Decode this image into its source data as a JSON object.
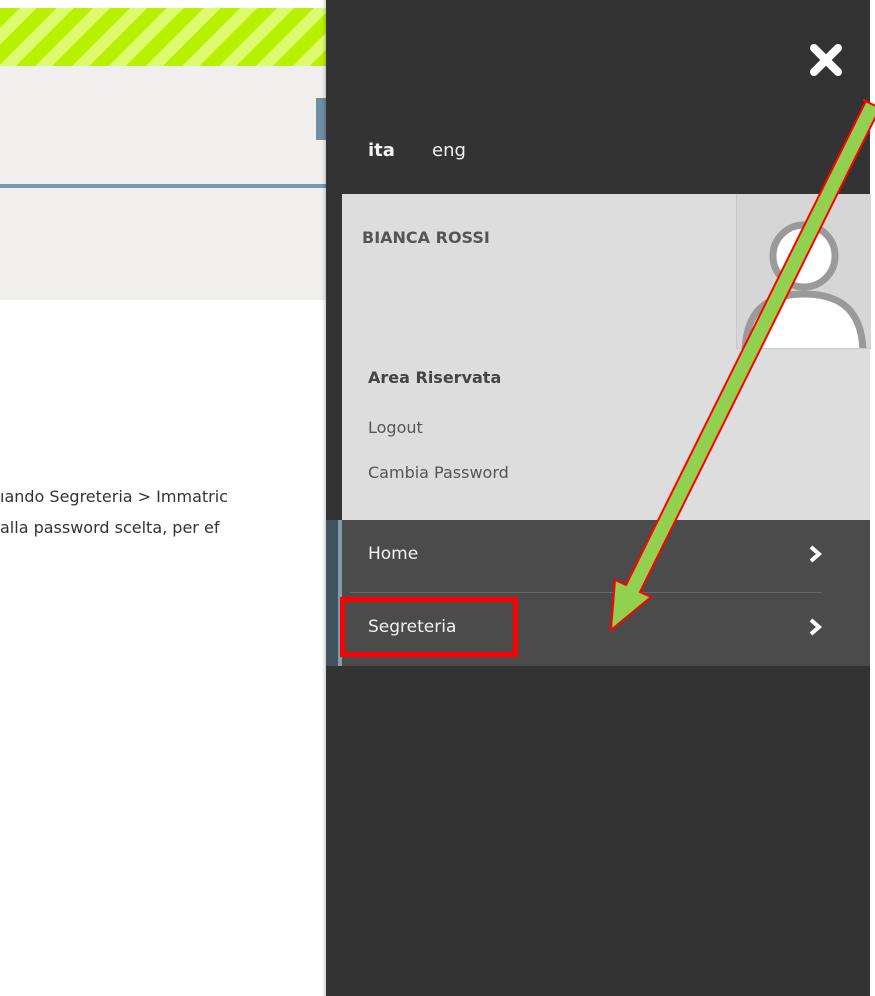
{
  "background": {
    "body_lines": [
      "ıando Segreteria > Immatric",
      " alla password scelta, per ef"
    ]
  },
  "panel": {
    "close_icon": "close-icon",
    "languages": [
      "ita",
      "eng"
    ],
    "active_language": "ita",
    "user": {
      "name": "BIANCA ROSSI",
      "avatar_icon": "user-avatar-icon",
      "area_title": "Area Riservata",
      "links": [
        "Logout",
        "Cambia Password"
      ]
    },
    "menu": [
      {
        "label": "Home",
        "icon": "chevron-right-icon"
      },
      {
        "label": "Segreteria",
        "icon": "chevron-right-icon"
      }
    ]
  },
  "annotations": {
    "highlight_color": "#ff0000",
    "arrow_fill": "#92d050",
    "arrow_stroke": "#ff0000"
  },
  "colors": {
    "panel_bg": "#333333",
    "user_box_bg": "#dddddd",
    "menu_bg": "#4b4b4b",
    "stripe": "#b9f000"
  }
}
